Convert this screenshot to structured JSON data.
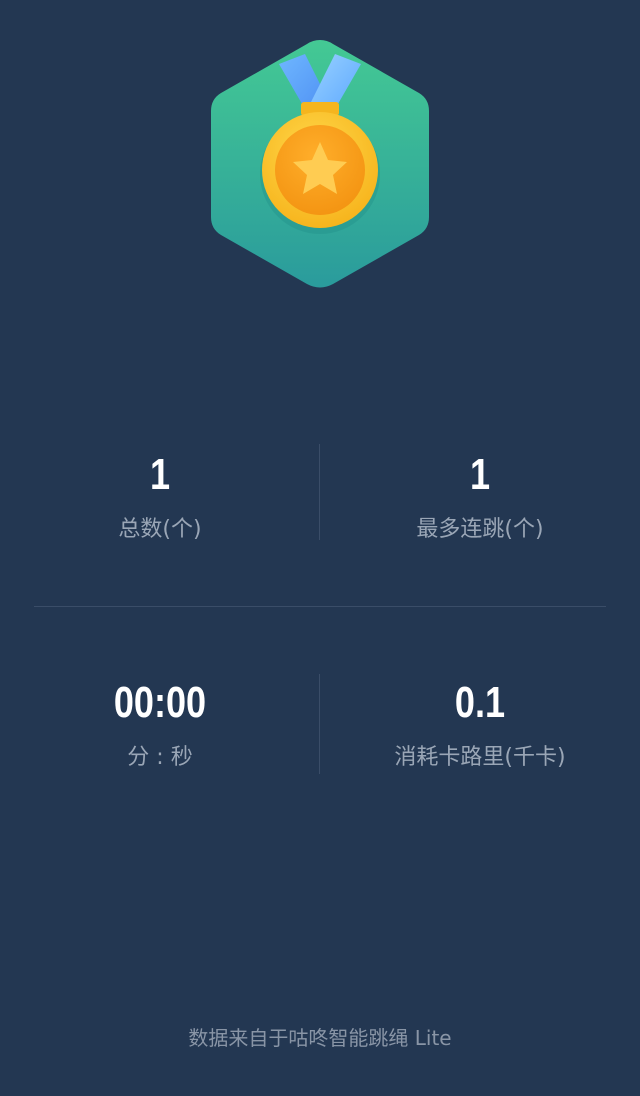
{
  "stats": {
    "total_count": {
      "value": "1",
      "label": "总数(个)"
    },
    "max_streak": {
      "value": "1",
      "label": "最多连跳(个)"
    },
    "duration": {
      "value": "00:00",
      "label": "分 : 秒"
    },
    "calories": {
      "value": "0.1",
      "label": "消耗卡路里(千卡)"
    }
  },
  "footer": {
    "text": "数据来自于咕咚智能跳绳 Lite"
  },
  "badge": {
    "icon": "medal-star-icon"
  },
  "colors": {
    "background": "#233752",
    "hex_badge_top": "#3fc394",
    "hex_badge_bottom": "#2a9a9a",
    "ribbon": "#5aa8ff",
    "medal_gold": "#ffc233",
    "medal_orange": "#f39c12"
  }
}
